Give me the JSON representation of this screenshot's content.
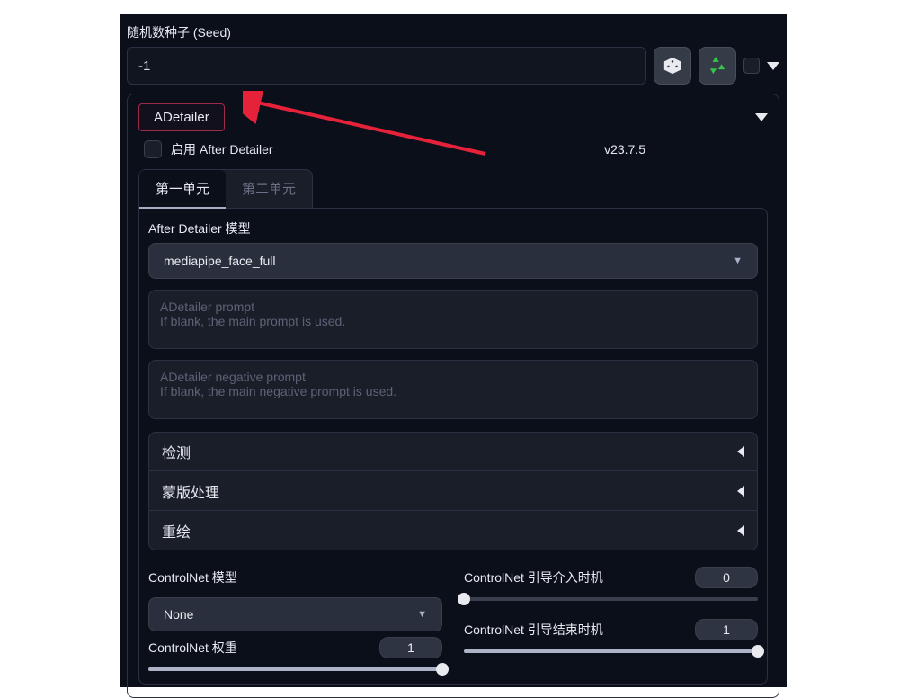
{
  "seed": {
    "label": "随机数种子 (Seed)",
    "value": "-1"
  },
  "adetailer": {
    "title": "ADetailer",
    "enable_label": "启用 After Detailer",
    "version": "v23.7.5",
    "tabs": {
      "unit1": "第一单元",
      "unit2": "第二单元"
    },
    "model_label": "After Detailer 模型",
    "model_value": "mediapipe_face_full",
    "prompt_placeholder": "ADetailer prompt\nIf blank, the main prompt is used.",
    "neg_prompt_placeholder": "ADetailer negative prompt\nIf blank, the main negative prompt is used.",
    "accordions": {
      "detect": "检测",
      "mask": "蒙版处理",
      "inpaint": "重绘"
    },
    "controlnet": {
      "model_label": "ControlNet 模型",
      "model_value": "None",
      "weight_label": "ControlNet 权重",
      "weight_value": "1",
      "weight_fill_pct": 100,
      "start_label": "ControlNet 引导介入时机",
      "start_value": "0",
      "start_fill_pct": 0,
      "end_label": "ControlNet 引导结束时机",
      "end_value": "1",
      "end_fill_pct": 100
    }
  }
}
